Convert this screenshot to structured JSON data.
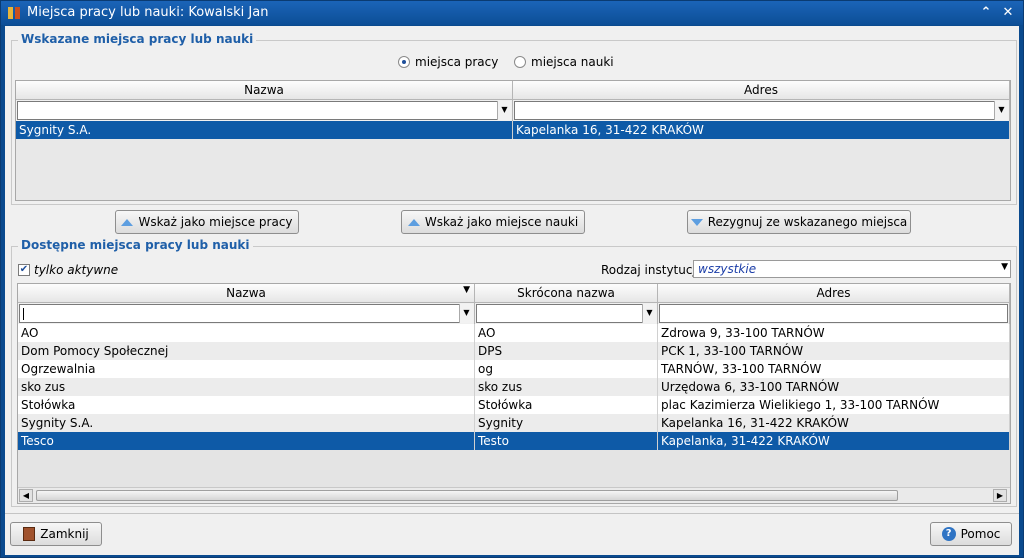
{
  "window": {
    "title": "Miejsca pracy lub nauki: Kowalski Jan",
    "icon": "app-icon",
    "controls": [
      "collapse-icon",
      "close-icon"
    ]
  },
  "indicated": {
    "legend": "Wskazane miejsca pracy lub nauki",
    "radio_work": "miejsca pracy",
    "radio_study": "miejsca nauki",
    "radio_selected": "miejsca pracy",
    "columns": [
      "Nazwa",
      "Adres"
    ],
    "rows": [
      {
        "nazwa": "Sygnity S.A.",
        "adres": "Kapelanka 16, 31-422 KRAKÓW",
        "selected": true
      }
    ]
  },
  "actions": {
    "indicate_work": "Wskaż jako miejsce pracy",
    "indicate_study": "Wskaż jako miejsce nauki",
    "resign": "Rezygnuj ze wskazanego miejsca"
  },
  "available": {
    "legend": "Dostępne miejsca pracy lub nauki",
    "active_only_label": "tylko aktywne",
    "active_only_checked": true,
    "institution_label": "Rodzaj instytucji:",
    "institution_value": "wszystkie",
    "columns": [
      "Nazwa",
      "Skrócona nazwa",
      "Adres"
    ],
    "rows": [
      {
        "nazwa": "AO",
        "skrot": "AO",
        "adres": "Zdrowa 9, 33-100 TARNÓW",
        "selected": false
      },
      {
        "nazwa": "Dom Pomocy Społecznej",
        "skrot": "DPS",
        "adres": "PCK 1, 33-100 TARNÓW",
        "selected": false
      },
      {
        "nazwa": "Ogrzewalnia",
        "skrot": "og",
        "adres": "TARNÓW, 33-100 TARNÓW",
        "selected": false
      },
      {
        "nazwa": "sko zus",
        "skrot": "sko zus",
        "adres": "Urzędowa 6, 33-100 TARNÓW",
        "selected": false
      },
      {
        "nazwa": "Stołówka",
        "skrot": "Stołówka",
        "adres": "plac Kazimierza Wielikiego 1, 33-100 TARNÓW",
        "selected": false
      },
      {
        "nazwa": "Sygnity S.A.",
        "skrot": "Sygnity",
        "adres": "Kapelanka 16, 31-422 KRAKÓW",
        "selected": false
      },
      {
        "nazwa": "Tesco",
        "skrot": "Testo",
        "adres": "Kapelanka, 31-422 KRAKÓW",
        "selected": true
      }
    ]
  },
  "footer": {
    "close_label": "Zamknij",
    "help_label": "Pomoc"
  },
  "colors": {
    "title_bar": "#0c4e96",
    "legend_text": "#1f5fa8",
    "selection": "#0e5aa7"
  }
}
